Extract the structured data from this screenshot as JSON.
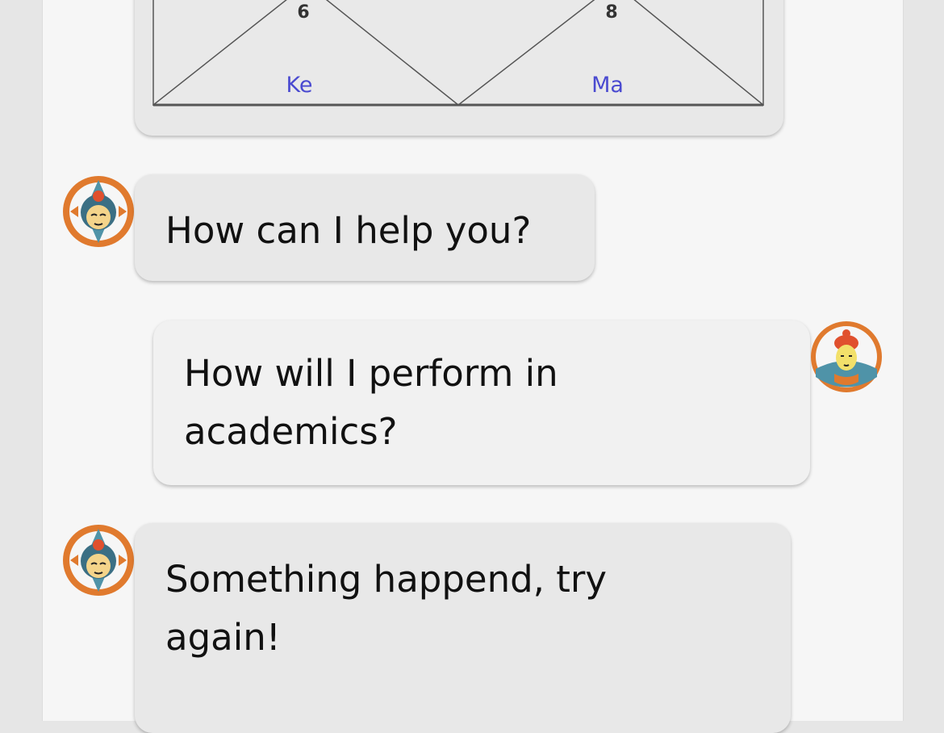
{
  "chart": {
    "house_numbers": [
      "6",
      "8"
    ],
    "planets": [
      "Ke",
      "Ma"
    ]
  },
  "messages": [
    {
      "role": "bot",
      "text": "How can I help you?"
    },
    {
      "role": "user",
      "text": "How will I perform in academics?"
    },
    {
      "role": "bot",
      "text": "Something happend, try again!"
    }
  ],
  "colors": {
    "planet_text": "#4a4ad0",
    "avatar_orange": "#e07a2e",
    "avatar_teal": "#4f93a8"
  }
}
